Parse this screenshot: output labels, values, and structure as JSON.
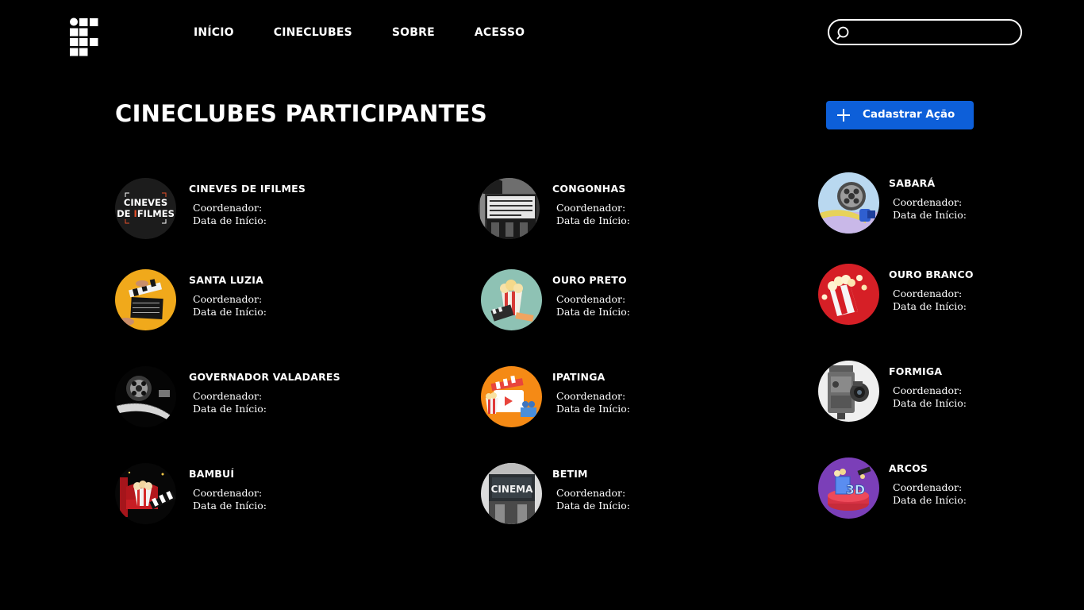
{
  "nav": {
    "items": [
      {
        "label": "INÍCIO"
      },
      {
        "label": "CINECLUBES"
      },
      {
        "label": "SOBRE"
      },
      {
        "label": "ACESSO"
      }
    ]
  },
  "search": {
    "value": "",
    "placeholder": ""
  },
  "page": {
    "title": "CINECLUBES PARTICIPANTES",
    "add_button_label": "Cadastrar Ação"
  },
  "colors": {
    "background": "#000000",
    "accent": "#0d5fd9",
    "text": "#ffffff"
  },
  "clubs": [
    {
      "name": "CINEVES DE IFILMES",
      "coordinator_label": "Coordenador:",
      "start_label": "Data de Início:",
      "logo_line1": "CINEVES",
      "logo_line2_a": "DE ",
      "logo_line2_b": "I",
      "logo_line2_c": "FILMES"
    },
    {
      "name": "CONGONHAS",
      "coordinator_label": "Coordenador:",
      "start_label": "Data de Início:"
    },
    {
      "name": "SABARÁ",
      "coordinator_label": "Coordenador:",
      "start_label": "Data de Início:"
    },
    {
      "name": "SANTA LUZIA",
      "coordinator_label": "Coordenador:",
      "start_label": "Data de Início:"
    },
    {
      "name": "OURO PRETO",
      "coordinator_label": "Coordenador:",
      "start_label": "Data de Início:"
    },
    {
      "name": "OURO BRANCO",
      "coordinator_label": "Coordenador:",
      "start_label": "Data de Início:"
    },
    {
      "name": "GOVERNADOR VALADARES",
      "coordinator_label": "Coordenador:",
      "start_label": "Data de Início:"
    },
    {
      "name": "IPATINGA",
      "coordinator_label": "Coordenador:",
      "start_label": "Data de Início:"
    },
    {
      "name": "FORMIGA",
      "coordinator_label": "Coordenador:",
      "start_label": "Data de Início:"
    },
    {
      "name": "BAMBUÍ",
      "coordinator_label": "Coordenador:",
      "start_label": "Data de Início:"
    },
    {
      "name": "BETIM",
      "coordinator_label": "Coordenador:",
      "start_label": "Data de Início:",
      "sign_text": "CINEMA"
    },
    {
      "name": "ARCOS",
      "coordinator_label": "Coordenador:",
      "start_label": "Data de Início:",
      "badge_text": "3D"
    }
  ]
}
